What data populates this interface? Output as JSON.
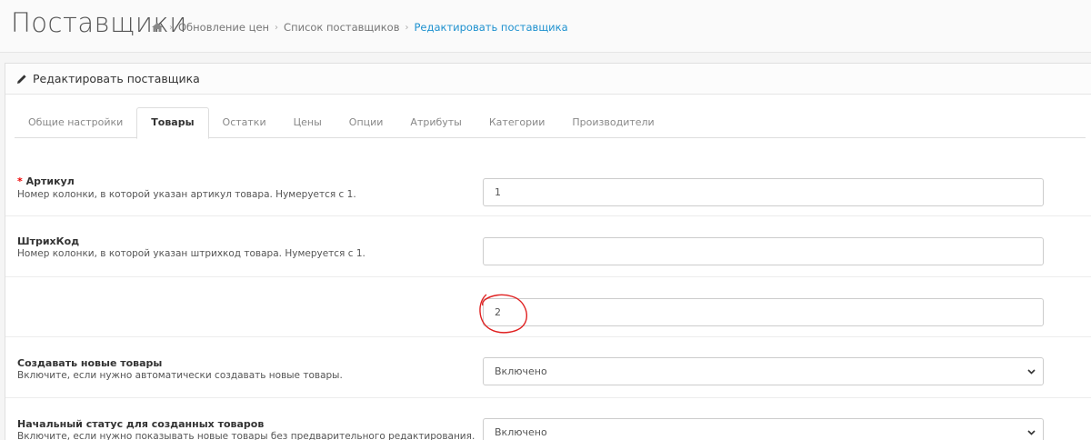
{
  "header": {
    "title": "Поставщики",
    "breadcrumb": [
      {
        "label": "Обновление цен"
      },
      {
        "label": "Список поставщиков"
      },
      {
        "label": "Редактировать поставщика"
      }
    ]
  },
  "panel": {
    "title": "Редактировать поставщика",
    "tabs": [
      {
        "label": "Общие настройки"
      },
      {
        "label": "Товары"
      },
      {
        "label": "Остатки"
      },
      {
        "label": "Цены"
      },
      {
        "label": "Опции"
      },
      {
        "label": "Атрибуты"
      },
      {
        "label": "Категории"
      },
      {
        "label": "Производители"
      }
    ],
    "active_tab": "Товары"
  },
  "form": {
    "sku": {
      "required_mark": "*",
      "label": "Артикул",
      "help": "Номер колонки, в которой указан артикул товара. Нумеруется с 1.",
      "value": "1"
    },
    "barcode": {
      "label": "ШтрихКод",
      "help": "Номер колонки, в которой указан штрихкод товара. Нумеруется с 1.",
      "value": ""
    },
    "unlabeled": {
      "value": "2"
    },
    "create_new": {
      "label": "Создавать новые товары",
      "help": "Включите, если нужно автоматически создавать новые товары.",
      "value": "Включено"
    },
    "initial_status": {
      "label": "Начальный статус для созданных товаров",
      "help": "Включите, если нужно показывать новые товары без предварительного редактирования.",
      "value": "Включено"
    }
  },
  "colors": {
    "accent": "#1e91cf",
    "required": "#e00000",
    "annotation": "#e02020"
  }
}
